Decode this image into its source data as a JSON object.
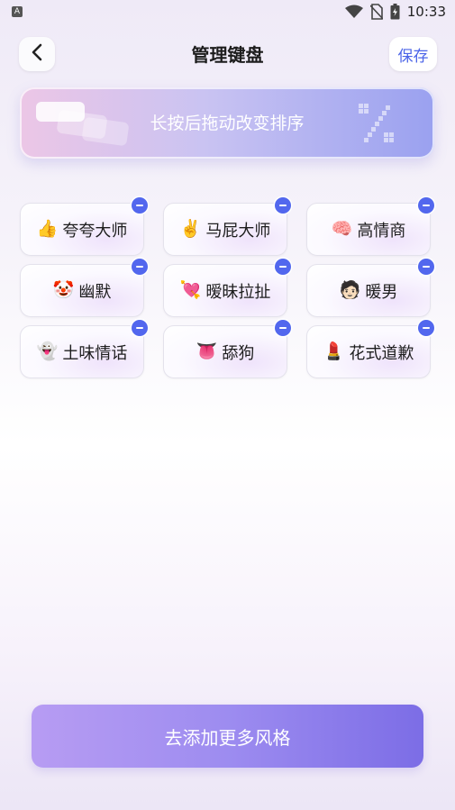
{
  "status_bar": {
    "time": "10:33",
    "left_badge": "A"
  },
  "header": {
    "title": "管理键盘",
    "save_label": "保存"
  },
  "banner": {
    "text": "长按后拖动改变排序"
  },
  "keyboards": [
    {
      "emoji": "👍",
      "label": "夸夸大师"
    },
    {
      "emoji": "✌️",
      "label": "马屁大师"
    },
    {
      "emoji": "🧠",
      "label": "高情商"
    },
    {
      "emoji": "🤡",
      "label": "幽默"
    },
    {
      "emoji": "💘",
      "label": "暧昧拉扯"
    },
    {
      "emoji": "🧑🏻",
      "label": "暖男"
    },
    {
      "emoji": "👻",
      "label": "土味情话"
    },
    {
      "emoji": "👅",
      "label": "舔狗"
    },
    {
      "emoji": "💄",
      "label": "花式道歉"
    }
  ],
  "footer": {
    "add_more_label": "去添加更多风格"
  },
  "colors": {
    "accent": "#5267ee",
    "button_gradient_start": "#b79cf3",
    "button_gradient_end": "#7c6de6"
  }
}
